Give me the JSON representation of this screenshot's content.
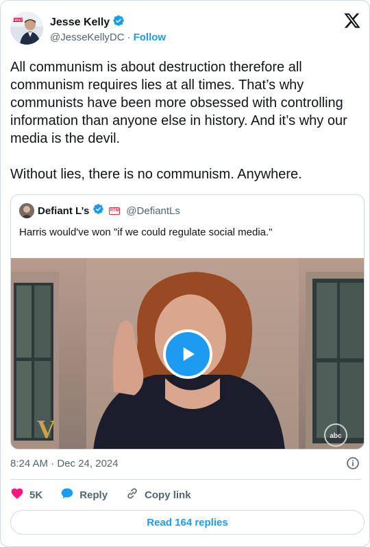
{
  "author": {
    "name": "Jesse Kelly",
    "handle": "@JesseKellyDC",
    "separator": "·",
    "follow_label": "Follow",
    "avatar_badge_text": "FIRST"
  },
  "tweet": {
    "text": "All communism is about destruction therefore all communism requires lies at all times. That’s why communists have been more obsessed with controlling information than anyone else in history. And it’s why our media is the devil.\n\nWithout lies, there is no communism. Anywhere."
  },
  "quote": {
    "name": "Defiant L’s",
    "badge_text": "RTM",
    "handle": "@DefiantLs",
    "text": "Harris would've won \"if we could regulate social media.\"",
    "video": {
      "show_logo_text": "V",
      "network_logo_text": "abc"
    }
  },
  "meta": {
    "timestamp": "8:24 AM · Dec 24, 2024"
  },
  "actions": {
    "like_count": "5K",
    "reply_label": "Reply",
    "copy_link_label": "Copy link"
  },
  "footer": {
    "read_replies_label": "Read 164 replies"
  },
  "colors": {
    "accent": "#1d9bf0",
    "like": "#f91880",
    "text": "#0f1419",
    "muted": "#536471",
    "border": "#cfd9de"
  }
}
